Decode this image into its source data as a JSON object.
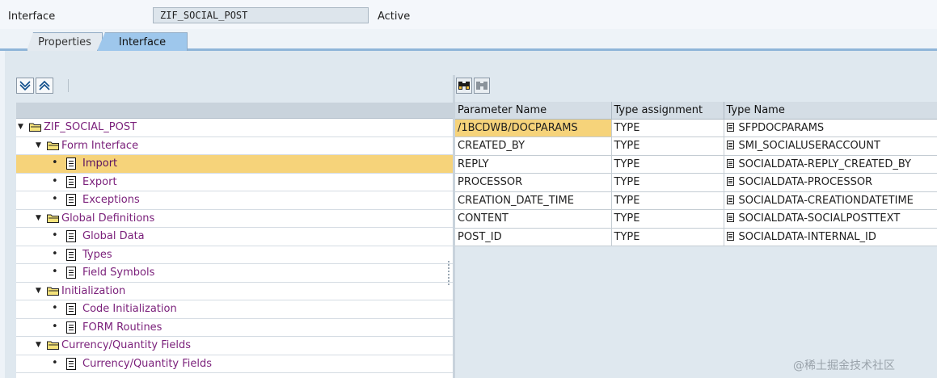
{
  "header": {
    "label": "Interface",
    "object_name": "ZIF_SOCIAL_POST",
    "status": "Active"
  },
  "tabs": [
    {
      "label": "Properties",
      "active": false
    },
    {
      "label": "Interface",
      "active": true
    }
  ],
  "left_toolbar": {
    "expand_icon": "expand-all-icon",
    "collapse_icon": "collapse-all-icon"
  },
  "tree": [
    {
      "label": "ZIF_SOCIAL_POST",
      "kind": "folder",
      "level": 0,
      "expanded": true
    },
    {
      "label": "Form Interface",
      "kind": "folder",
      "level": 1,
      "expanded": true
    },
    {
      "label": "Import",
      "kind": "doc",
      "level": 2,
      "selected": true
    },
    {
      "label": "Export",
      "kind": "doc",
      "level": 2
    },
    {
      "label": "Exceptions",
      "kind": "doc",
      "level": 2
    },
    {
      "label": "Global Definitions",
      "kind": "folder",
      "level": 1,
      "expanded": true
    },
    {
      "label": "Global Data",
      "kind": "doc",
      "level": 2
    },
    {
      "label": "Types",
      "kind": "doc",
      "level": 2
    },
    {
      "label": "Field Symbols",
      "kind": "doc",
      "level": 2
    },
    {
      "label": "Initialization",
      "kind": "folder",
      "level": 1,
      "expanded": true
    },
    {
      "label": "Code Initialization",
      "kind": "doc",
      "level": 2
    },
    {
      "label": "FORM Routines",
      "kind": "doc",
      "level": 2
    },
    {
      "label": "Currency/Quantity Fields",
      "kind": "folder",
      "level": 1,
      "expanded": true
    },
    {
      "label": "Currency/Quantity Fields",
      "kind": "doc",
      "level": 2
    }
  ],
  "right_toolbar": {
    "find_icon": "binoculars-icon",
    "find_next_icon": "binoculars-next-icon"
  },
  "table": {
    "columns": [
      "Parameter Name",
      "Type assignment",
      "Type Name"
    ],
    "rows": [
      [
        "/1BCDWB/DOCPARAMS",
        "TYPE",
        "SFPDOCPARAMS"
      ],
      [
        "CREATED_BY",
        "TYPE",
        "SMI_SOCIALUSERACCOUNT"
      ],
      [
        "REPLY",
        "TYPE",
        "SOCIALDATA-REPLY_CREATED_BY"
      ],
      [
        "PROCESSOR",
        "TYPE",
        "SOCIALDATA-PROCESSOR"
      ],
      [
        "CREATION_DATE_TIME",
        "TYPE",
        "SOCIALDATA-CREATIONDATETIME"
      ],
      [
        "CONTENT",
        "TYPE",
        "SOCIALDATA-SOCIALPOSTTEXT"
      ],
      [
        "POST_ID",
        "TYPE",
        "SOCIALDATA-INTERNAL_ID"
      ]
    ]
  },
  "watermark": "@稀土掘金技术社区"
}
